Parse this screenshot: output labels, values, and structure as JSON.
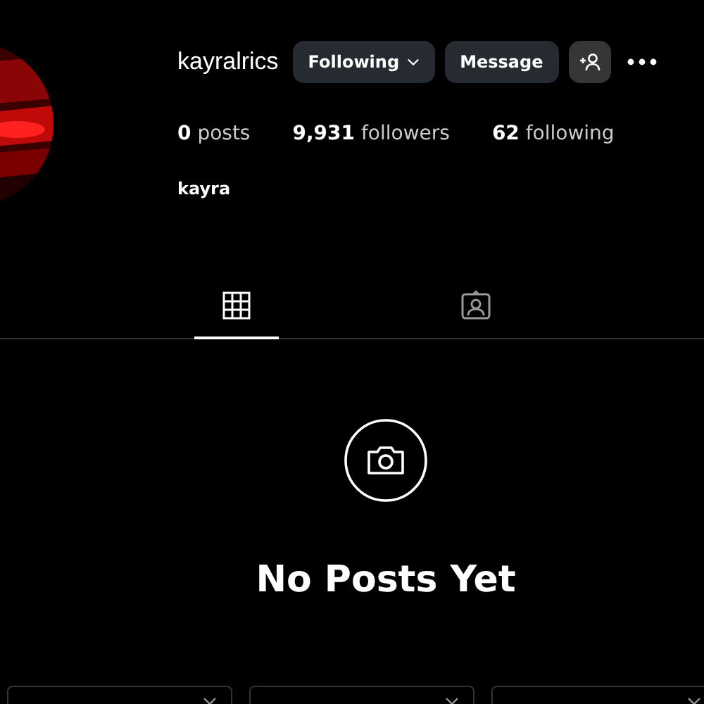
{
  "profile": {
    "username": "kayralrics",
    "follow_button": {
      "label": "Following"
    },
    "message_button": {
      "label": "Message"
    },
    "stats": [
      {
        "number": "0",
        "label": "posts"
      },
      {
        "number": "9,931",
        "label": "followers"
      },
      {
        "number": "62",
        "label": "following"
      }
    ],
    "display_name": "kayra"
  },
  "tabs": [
    {
      "kind": "grid",
      "selected": true
    },
    {
      "kind": "tagged",
      "selected": false
    }
  ],
  "empty_state": {
    "title": "No Posts Yet"
  },
  "suggestion_cards": [
    {
      "kind": "card"
    },
    {
      "kind": "card"
    },
    {
      "kind": "card"
    }
  ]
}
